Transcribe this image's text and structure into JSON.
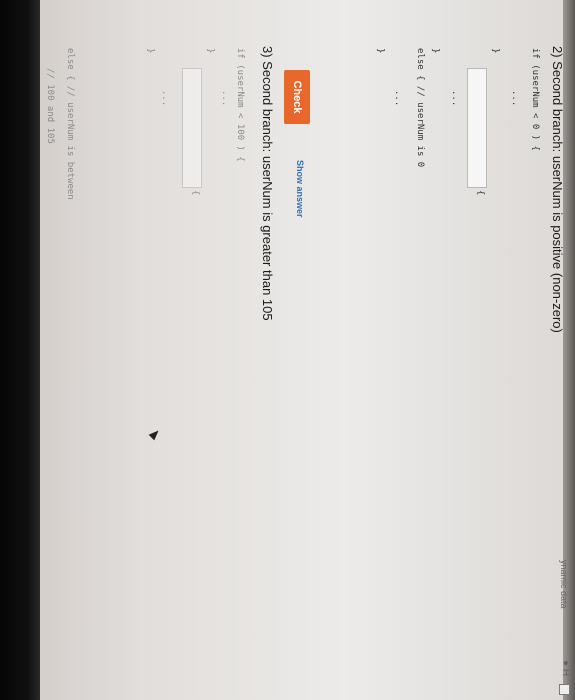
{
  "header": {
    "top_right_text": "ynamic data",
    "top_right_badge": "H"
  },
  "q2": {
    "title": "2) Second branch: userNum is positive (non-zero)",
    "line1": "if (userNum < 0 ) {",
    "line2": "...",
    "line3": "}",
    "blank_suffix": "{",
    "line5": "...",
    "line6": "}",
    "line7": "else { // userNum is 0",
    "line8": "...",
    "line9": "}"
  },
  "actions": {
    "check_label": "Check",
    "show_answer_label": "Show answer"
  },
  "q3": {
    "title": "3) Second branch: userNum is greater than 105",
    "line1": "if (userNum < 100 ) {",
    "line2": "...",
    "line3": "}",
    "blank_suffix": "{",
    "line5": "...",
    "line6": "}",
    "line7": "else { // userNum is between",
    "line8": "// 100 and 105"
  }
}
